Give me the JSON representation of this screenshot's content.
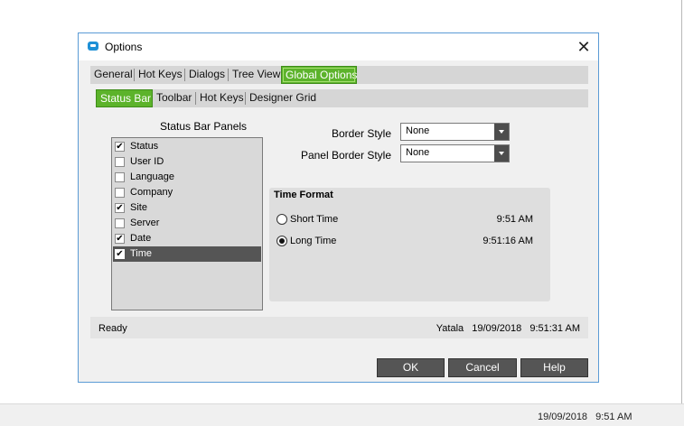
{
  "dialog": {
    "title": "Options",
    "close_glyph": "✕",
    "icon": "app-icon"
  },
  "tabs_main": [
    {
      "label": "General",
      "active": false
    },
    {
      "label": "Hot Keys",
      "active": false
    },
    {
      "label": "Dialogs",
      "active": false
    },
    {
      "label": "Tree View",
      "active": false
    },
    {
      "label": "Global Options",
      "active": true
    }
  ],
  "tabs_sub": [
    {
      "label": "Status Bar",
      "active": true
    },
    {
      "label": "Toolbar",
      "active": false
    },
    {
      "label": "Hot Keys",
      "active": false
    },
    {
      "label": "Designer Grid",
      "active": false
    }
  ],
  "status_panels": {
    "heading": "Status Bar Panels",
    "check_glyph": "✔",
    "items": [
      {
        "label": "Status",
        "checked": true
      },
      {
        "label": "User ID",
        "checked": false
      },
      {
        "label": "Language",
        "checked": false
      },
      {
        "label": "Company",
        "checked": false
      },
      {
        "label": "Site",
        "checked": true
      },
      {
        "label": "Server",
        "checked": false
      },
      {
        "label": "Date",
        "checked": true
      },
      {
        "label": "Time",
        "checked": true
      }
    ],
    "selected_index": 7
  },
  "border_style": {
    "label": "Border Style",
    "value": "None"
  },
  "panel_border_style": {
    "label": "Panel Border Style",
    "value": "None"
  },
  "time_format": {
    "title": "Time Format",
    "options": [
      {
        "label": "Short Time",
        "example": "9:51 AM",
        "selected": false
      },
      {
        "label": "Long Time",
        "example": "9:51:16 AM",
        "selected": true
      }
    ]
  },
  "status_bar": {
    "left": "Ready",
    "site": "Yatala",
    "date": "19/09/2018",
    "time": "9:51:31 AM"
  },
  "buttons": {
    "ok": "OK",
    "cancel": "Cancel",
    "help": "Help"
  },
  "taskbar": {
    "date": "19/09/2018",
    "time": "9:51 AM"
  },
  "colors": {
    "accent_green": "#5cb32b",
    "button_dark": "#555555",
    "dialog_border": "#5b9bd5"
  }
}
